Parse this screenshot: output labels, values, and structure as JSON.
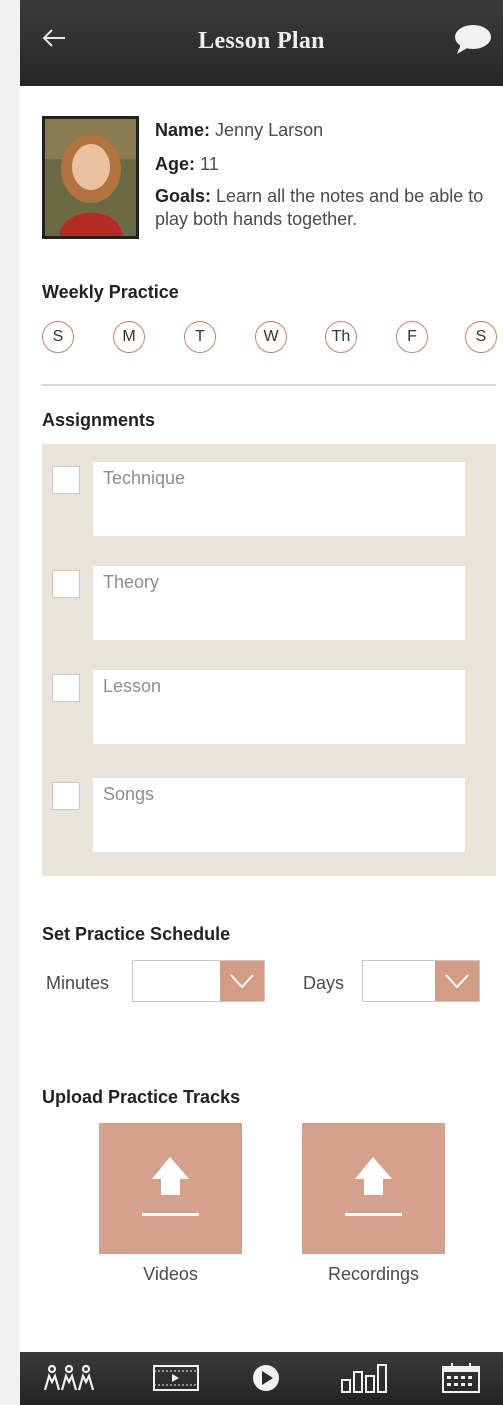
{
  "header": {
    "title": "Lesson Plan",
    "back_icon": "back-arrow-icon",
    "chat_icon": "chat-bubble-icon"
  },
  "profile": {
    "name_label": "Name:",
    "name": "Jenny Larson",
    "age_label": "Age:",
    "age": "11",
    "goals_label": "Goals:",
    "goals": "Learn all the notes and be able to play both hands together."
  },
  "weekly_practice": {
    "title": "Weekly Practice",
    "days": [
      "S",
      "M",
      "T",
      "W",
      "Th",
      "F",
      "S"
    ]
  },
  "assignments": {
    "title": "Assignments",
    "items": [
      {
        "placeholder": "Technique"
      },
      {
        "placeholder": "Theory"
      },
      {
        "placeholder": "Lesson"
      },
      {
        "placeholder": "Songs"
      }
    ]
  },
  "schedule": {
    "title": "Set Practice Schedule",
    "minutes_label": "Minutes",
    "days_label": "Days"
  },
  "upload": {
    "title": "Upload Practice Tracks",
    "videos_label": "Videos",
    "recordings_label": "Recordings"
  },
  "nav": [
    "people-icon",
    "video-icon",
    "play-icon",
    "chart-icon",
    "calendar-icon"
  ],
  "colors": {
    "accent": "#d29c85",
    "header": "#2f2f2f",
    "panel": "#e8e4dc",
    "day_border": "#c9826e"
  }
}
